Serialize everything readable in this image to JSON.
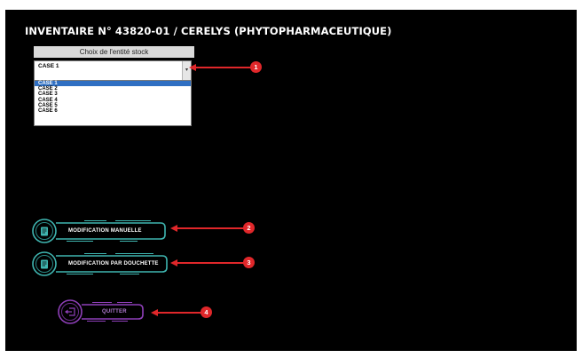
{
  "title": "INVENTAIRE N° 43820-01 / CERELYS (PHYTOPHARMACEUTIQUE)",
  "stock_selector": {
    "header": "Choix de l'entité stock",
    "selected_value": "CASE 1",
    "options": [
      "CASE 1",
      "CASE 2",
      "CASE 3",
      "CASE 4",
      "CASE 5",
      "CASE 6"
    ],
    "highlighted_index": 0
  },
  "buttons": {
    "manual_label": "MODIFICATION MANUELLE",
    "scanner_label": "MODIFICATION PAR DOUCHETTE",
    "quit_label": "QUITTER"
  },
  "callouts": [
    "1",
    "2",
    "3",
    "4"
  ],
  "colors": {
    "background": "#000000",
    "teal_accent": "#3fb5b0",
    "purple_accent": "#8e3fb8",
    "callout_red": "#e0272a",
    "selection_blue": "#2f6fc2"
  },
  "icons": {
    "manual": "document-edit-icon",
    "scanner": "document-scan-icon",
    "quit": "logout-icon",
    "dropdown": "chevron-down-icon"
  }
}
